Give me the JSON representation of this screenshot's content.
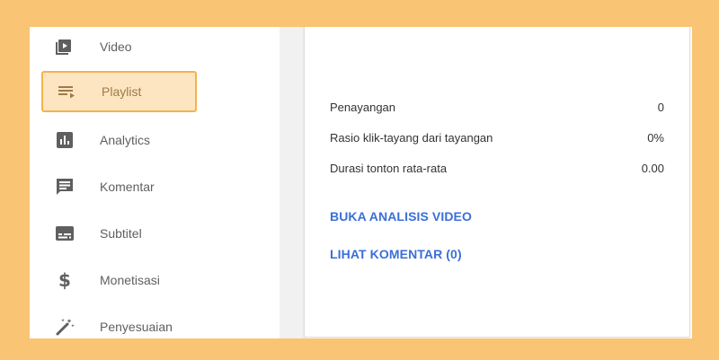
{
  "sidebar": {
    "items": [
      {
        "label": "Video",
        "icon": "video-icon"
      },
      {
        "label": "Playlist",
        "icon": "playlist-icon",
        "active": true
      },
      {
        "label": "Analytics",
        "icon": "analytics-icon"
      },
      {
        "label": "Komentar",
        "icon": "comment-icon"
      },
      {
        "label": "Subtitel",
        "icon": "subtitle-icon"
      },
      {
        "label": "Monetisasi",
        "icon": "dollar-icon"
      },
      {
        "label": "Penyesuaian",
        "icon": "magic-wand-icon"
      }
    ]
  },
  "stats": {
    "rows": [
      {
        "label": "Penayangan",
        "value": "0"
      },
      {
        "label": "Rasio klik-tayang dari tayangan",
        "value": "0%"
      },
      {
        "label": "Durasi tonton rata-rata",
        "value": "0.00"
      }
    ]
  },
  "links": {
    "analysis": "BUKA ANALISIS VIDEO",
    "comments": "LIHAT KOMENTAR (0)"
  },
  "colors": {
    "background": "#f9c473",
    "active_fill": "#fde5c2",
    "active_border": "#f2b34c",
    "link": "#3a6fd8",
    "icon": "#5f5f5f"
  }
}
